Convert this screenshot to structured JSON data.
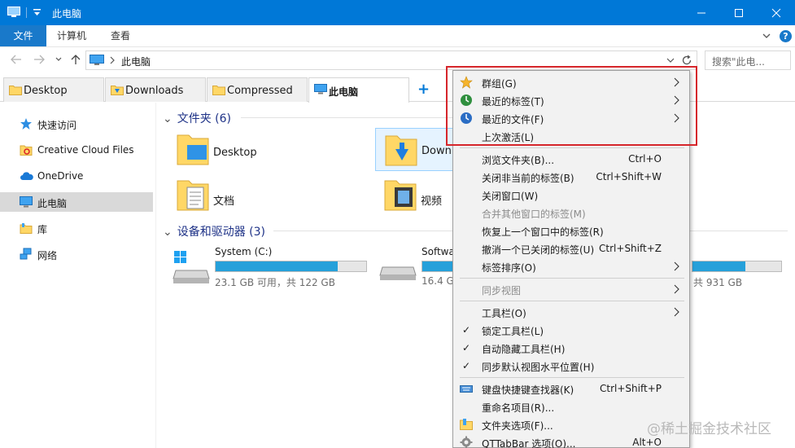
{
  "window": {
    "title": "此电脑",
    "accent": "#0078d7"
  },
  "ribbon": {
    "tabs": [
      "文件",
      "计算机",
      "查看"
    ]
  },
  "address": {
    "path": "此电脑",
    "search_placeholder": "搜索\"此电..."
  },
  "qttabs": [
    {
      "label": "Desktop",
      "icon": "folder-icon"
    },
    {
      "label": "Downloads",
      "icon": "downloads-folder-icon"
    },
    {
      "label": "Compressed",
      "icon": "folder-icon"
    },
    {
      "label": "此电脑",
      "icon": "computer-icon",
      "active": true
    }
  ],
  "sidebar": {
    "items": [
      {
        "label": "快速访问",
        "icon": "star-icon"
      },
      {
        "label": "Creative Cloud Files",
        "icon": "creative-cloud-icon"
      },
      {
        "label": "OneDrive",
        "icon": "cloud-icon"
      },
      {
        "label": "此电脑",
        "icon": "computer-icon",
        "selected": true
      },
      {
        "label": "库",
        "icon": "library-icon"
      },
      {
        "label": "网络",
        "icon": "network-icon"
      }
    ]
  },
  "content": {
    "folders_header": "文件夹 (6)",
    "folders": [
      {
        "label": "Desktop",
        "icon": "desktop-folder-icon"
      },
      {
        "label": "Downl",
        "icon": "downloads-folder-icon"
      },
      {
        "label": "文档",
        "icon": "documents-folder-icon"
      },
      {
        "label": "视频",
        "icon": "videos-folder-icon"
      }
    ],
    "drives_header": "设备和驱动器 (3)",
    "drives": [
      {
        "name": "System (C:)",
        "capacity": "23.1 GB 可用，共 122 GB",
        "used_fraction": 0.81,
        "icon": "windows-drive-icon"
      },
      {
        "name": "Softwa",
        "capacity": "16.4 G",
        "used_fraction": 0.9,
        "icon": "drive-icon"
      },
      {
        "capacity": "共 931 GB",
        "used_fraction": 0.6
      }
    ]
  },
  "menu": {
    "items": [
      {
        "label": "群组(G)",
        "icon": "star-icon",
        "submenu": true
      },
      {
        "label": "最近的标签(T)",
        "icon": "recent-tabs-icon",
        "submenu": true
      },
      {
        "label": "最近的文件(F)",
        "icon": "recent-files-icon",
        "submenu": true
      },
      {
        "label": "上次激活(L)"
      },
      {
        "label": "浏览文件夹(B)...",
        "shortcut": "Ctrl+O"
      },
      {
        "label": "关闭非当前的标签(B)",
        "shortcut": "Ctrl+Shift+W"
      },
      {
        "label": "关闭窗口(W)"
      },
      {
        "label": "合并其他窗口的标签(M)",
        "disabled": true
      },
      {
        "label": "恢复上一个窗口中的标签(R)"
      },
      {
        "label": "撤消一个已关闭的标签(U)",
        "shortcut": "Ctrl+Shift+Z"
      },
      {
        "label": "标签排序(O)",
        "submenu": true
      },
      {
        "label": "同步视图",
        "disabled": true,
        "submenu": true
      },
      {
        "label": "工具栏(O)",
        "submenu": true
      },
      {
        "label": "锁定工具栏(L)",
        "checked": true
      },
      {
        "label": "自动隐藏工具栏(H)",
        "checked": true
      },
      {
        "label": "同步默认视图水平位置(H)",
        "checked": true
      },
      {
        "label": "键盘快捷键查找器(K)",
        "shortcut": "Ctrl+Shift+P",
        "icon": "keyboard-icon"
      },
      {
        "label": "重命名项目(R)..."
      },
      {
        "label": "文件夹选项(F)...",
        "icon": "folder-options-icon"
      },
      {
        "label": "QTTabBar 选项(O)...",
        "shortcut": "Alt+O",
        "icon": "gear-icon"
      }
    ],
    "check_glyph": "✓"
  },
  "watermark": "@稀土掘金技术社区"
}
